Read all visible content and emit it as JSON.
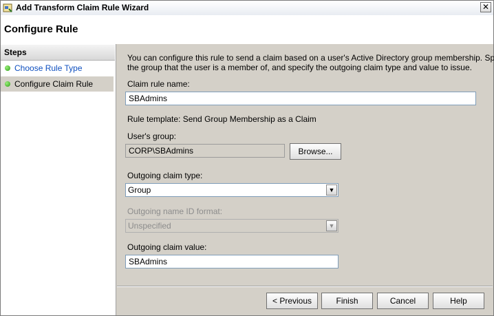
{
  "window": {
    "title": "Add Transform Claim Rule Wizard",
    "close_glyph": "✕"
  },
  "header": {
    "title": "Configure Rule"
  },
  "steps": {
    "heading": "Steps",
    "items": [
      {
        "label": "Choose Rule Type",
        "state": "link"
      },
      {
        "label": "Configure Claim Rule",
        "state": "current"
      }
    ]
  },
  "content": {
    "description_line1": "You can configure this rule to send a claim based on a user's Active Directory group membership. Specify",
    "description_line2": "the group that the user is a member of, and specify the outgoing claim type and value to issue.",
    "claim_rule_name_label": "Claim rule name:",
    "claim_rule_name_value": "SBAdmins",
    "rule_template_text": "Rule template: Send Group Membership as a Claim",
    "users_group_label": "User's group:",
    "users_group_value": "CORP\\SBAdmins",
    "browse_label": "Browse...",
    "outgoing_claim_type_label": "Outgoing claim type:",
    "outgoing_claim_type_value": "Group",
    "outgoing_name_id_label": "Outgoing name ID format:",
    "outgoing_name_id_value": "Unspecified",
    "outgoing_claim_value_label": "Outgoing claim value:",
    "outgoing_claim_value_value": "SBAdmins"
  },
  "footer": {
    "previous_label": "< Previous",
    "finish_label": "Finish",
    "cancel_label": "Cancel",
    "help_label": "Help"
  },
  "icons": {
    "app": "wizard-app-icon",
    "dropdown": "chevron-down-icon",
    "step_status": "green-dot-icon"
  }
}
